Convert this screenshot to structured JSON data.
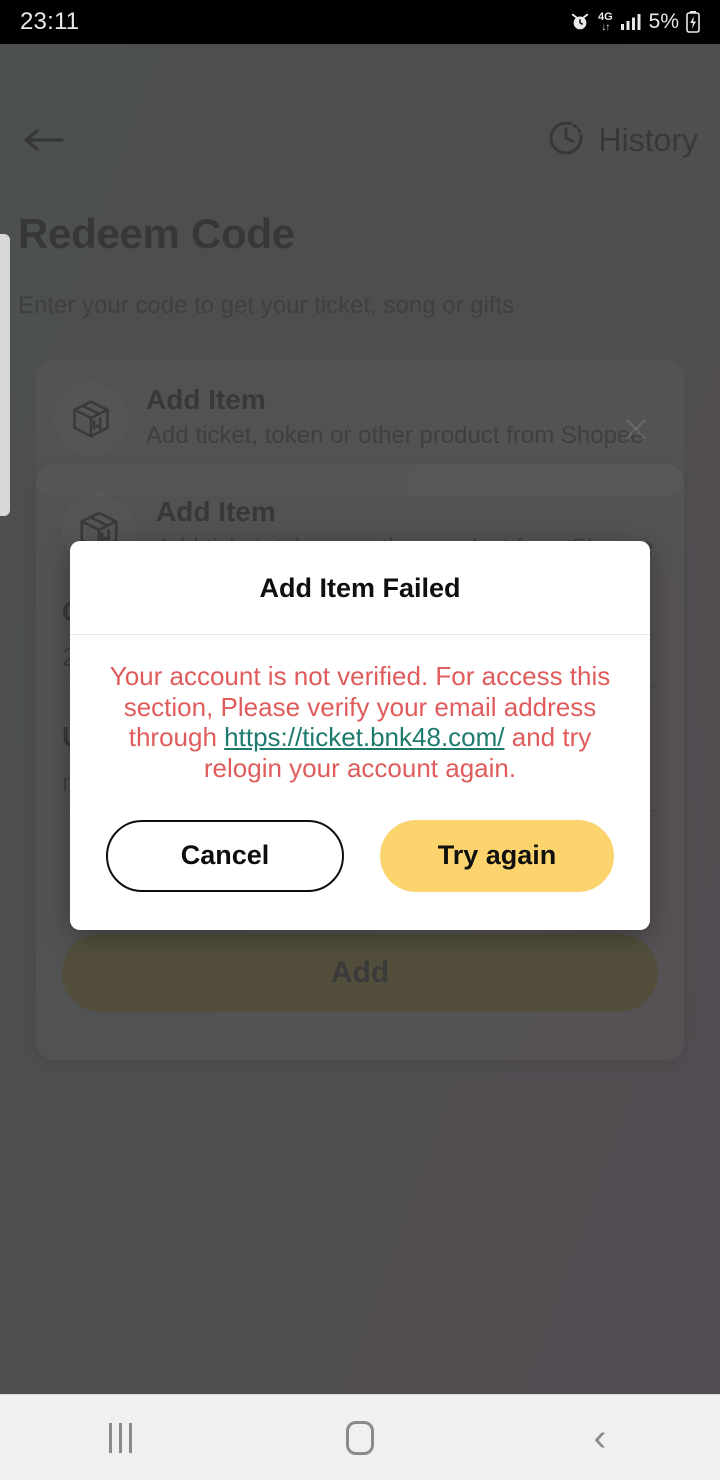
{
  "status_bar": {
    "time": "23:11",
    "alarm_icon": "alarm-icon",
    "network_label": "4G",
    "network_arrows": "↓↑",
    "signal_icon": "signal-bars-icon",
    "battery_percent": "5%",
    "battery_icon": "battery-charging-icon"
  },
  "app": {
    "back_icon": "back-arrow-icon",
    "history_icon": "history-clock-icon",
    "history_label": "History",
    "title": "Redeem Code",
    "subtitle": "Enter your code to get your ticket, song or gifts"
  },
  "card_one": {
    "icon": "package-box-icon",
    "title": "Add Item",
    "description": "Add ticket, token or other product from Shopee",
    "close_icon": "close-x-icon"
  },
  "bottom_sheet": {
    "icon": "package-box-icon",
    "title": "Add Item",
    "description": "Add ticket, token or other product from Shopee",
    "field_one_label": "C",
    "field_one_value": "2",
    "field_two_label": "U",
    "field_two_value": "n",
    "add_label": "Add"
  },
  "dialog": {
    "title": "Add Item Failed",
    "message_before_link": "Your account is not verified. For access this section, Please verify your email address through ",
    "link_text": "https://ticket.bnk48.com/",
    "message_after_link": " and try relogin your account again.",
    "cancel_label": "Cancel",
    "try_again_label": "Try again",
    "message_color": "#e05c5c",
    "link_color": "#1d7a6e",
    "accent_color": "#fbd46d"
  },
  "nav_bar": {
    "recents_icon": "recents-icon",
    "home_icon": "home-icon",
    "back_icon": "back-icon"
  }
}
